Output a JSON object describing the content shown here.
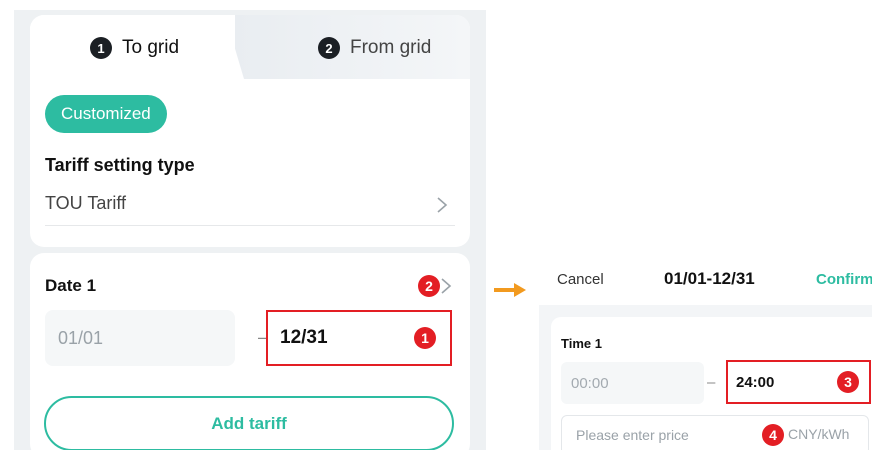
{
  "tabs": [
    {
      "number": "1",
      "label": "To grid",
      "active": true
    },
    {
      "number": "2",
      "label": "From grid",
      "active": false
    }
  ],
  "chip_label": "Customized",
  "tariff": {
    "label": "Tariff setting type",
    "value": "TOU Tariff"
  },
  "date": {
    "label": "Date 1",
    "start": "01/01",
    "separator": "–",
    "end": "12/31"
  },
  "add_tariff_label": "Add tariff",
  "annotations": {
    "badge1": "1",
    "badge2": "2",
    "badge3": "3",
    "badge4": "4"
  },
  "time_picker": {
    "cancel_label": "Cancel",
    "title": "01/01-12/31",
    "confirm_label": "Confirm",
    "time_label": "Time 1",
    "start": "00:00",
    "separator": "–",
    "end": "24:00",
    "price_placeholder": "Please enter price",
    "unit": "CNY/kWh"
  },
  "colors": {
    "accent": "#2dbca1",
    "annotation_red": "#e31e24",
    "arrow_orange": "#f29a1f"
  }
}
